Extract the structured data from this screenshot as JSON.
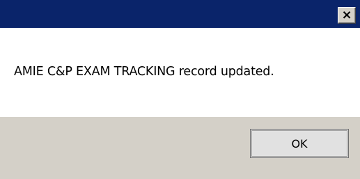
{
  "dialog": {
    "close_glyph": "×",
    "message": "AMIE C&P EXAM TRACKING record updated.",
    "ok_label": "OK"
  },
  "colors": {
    "title_bar": "#0a246a",
    "button_area": "#d4d0c8",
    "content_background": "#ffffff"
  },
  "icons": {
    "close": "close-icon"
  }
}
